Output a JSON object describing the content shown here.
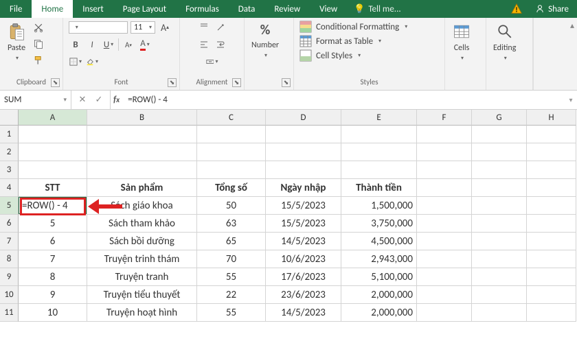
{
  "tabs": {
    "file": "File",
    "home": "Home",
    "insert": "Insert",
    "pagelayout": "Page Layout",
    "formulas": "Formulas",
    "data": "Data",
    "review": "Review",
    "view": "View"
  },
  "tell": "Tell me...",
  "share": "Share",
  "ribbon": {
    "clipboard": {
      "paste": "Paste",
      "label": "Clipboard"
    },
    "font": {
      "size": "11",
      "label": "Font"
    },
    "alignment": {
      "label": "Alignment"
    },
    "number": {
      "sym": "%",
      "label": "Number"
    },
    "styles": {
      "cond": "Conditional Formatting",
      "fat": "Format as Table",
      "cell": "Cell Styles",
      "label": "Styles"
    },
    "cells": {
      "label": "Cells"
    },
    "editing": {
      "label": "Editing"
    }
  },
  "fx": {
    "name": "SUM",
    "formula": "=ROW() - 4"
  },
  "cols": [
    "A",
    "B",
    "C",
    "D",
    "E",
    "F",
    "G",
    "H"
  ],
  "colw": [
    "wA",
    "wB",
    "wC",
    "wD",
    "wE",
    "wF",
    "wG",
    "wH"
  ],
  "headers": {
    "a": "STT",
    "b": "Sản phẩm",
    "c": "Tổng số",
    "d": "Ngày nhập",
    "e": "Thành tiền"
  },
  "active_cell_display": "=ROW() - 4",
  "data_rows": [
    {
      "r": 5,
      "a": "=ROW() - 4",
      "b": "Sách giáo khoa",
      "c": "50",
      "d": "15/5/2023",
      "e": "1,500,000"
    },
    {
      "r": 6,
      "a": "5",
      "b": "Sách tham khảo",
      "c": "63",
      "d": "15/5/2023",
      "e": "3,750,000"
    },
    {
      "r": 7,
      "a": "6",
      "b": "Sách bồi dưỡng",
      "c": "65",
      "d": "14/5/2023",
      "e": "4,500,000"
    },
    {
      "r": 8,
      "a": "7",
      "b": "Truyện trinh thám",
      "c": "70",
      "d": "10/6/2023",
      "e": "2,943,000"
    },
    {
      "r": 9,
      "a": "8",
      "b": "Truyện tranh",
      "c": "55",
      "d": "17/6/2023",
      "e": "5,100,000"
    },
    {
      "r": 10,
      "a": "9",
      "b": "Truyện tiểu thuyết",
      "c": "22",
      "d": "23/6/2023",
      "e": "2,000,000"
    },
    {
      "r": 11,
      "a": "10",
      "b": "Truyện hoạt hình",
      "c": "55",
      "d": "14/5/2023",
      "e": "2,000,000"
    }
  ]
}
